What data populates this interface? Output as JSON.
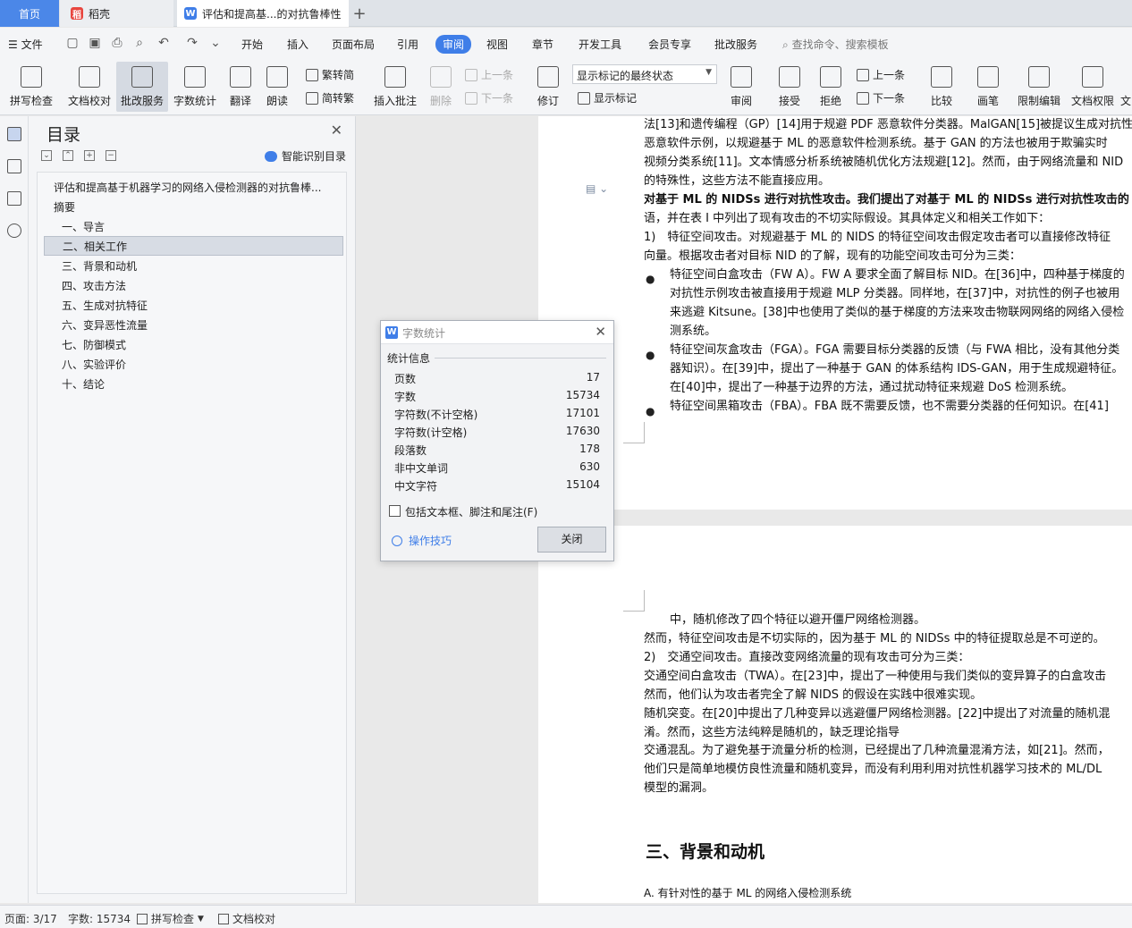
{
  "tabs": {
    "home": "首页",
    "daoke": "稻壳",
    "doc": "评估和提高基...的对抗鲁棒性",
    "plus": "+"
  },
  "menubar": {
    "file": "文件",
    "items": [
      "开始",
      "插入",
      "页面布局",
      "引用",
      "审阅",
      "视图",
      "章节",
      "开发工具",
      "会员专享",
      "批改服务"
    ],
    "active": "审阅",
    "search": "查找命令、搜索模板"
  },
  "ribbon": {
    "spell": "拼写检查",
    "proofread": "文档校对",
    "correction": "批改服务",
    "wordcount": "字数统计",
    "translate": "翻译",
    "read": "朗读",
    "trad": "繁转简",
    "simp": "简转繁",
    "insert_comment": "插入批注",
    "delete": "删除",
    "prev_comment": "上一条",
    "next_comment": "下一条",
    "revise": "修订",
    "markup_state": "显示标记的最终状态",
    "show_markup": "显示标记",
    "review": "审阅",
    "accept": "接受",
    "reject": "拒绝",
    "prev_change": "上一条",
    "next_change": "下一条",
    "compare": "比较",
    "pen": "画笔",
    "restrict": "限制编辑",
    "permission": "文档权限",
    "more": "文"
  },
  "nav": {
    "title": "目录",
    "smart": "智能识别目录",
    "items": [
      "评估和提高基于机器学习的网络入侵检测器的对抗鲁棒...",
      "摘要",
      "一、导言",
      "二、相关工作",
      "三、背景和动机",
      "四、攻击方法",
      "五、生成对抗特征",
      "六、变异恶性流量",
      "七、防御模式",
      "八、实验评价",
      "十、结论"
    ],
    "selected_index": 3
  },
  "dialog": {
    "title": "字数统计",
    "section": "统计信息",
    "stats": [
      {
        "label": "页数",
        "value": "17"
      },
      {
        "label": "字数",
        "value": "15734"
      },
      {
        "label": "字符数(不计空格)",
        "value": "17101"
      },
      {
        "label": "字符数(计空格)",
        "value": "17630"
      },
      {
        "label": "段落数",
        "value": "178"
      },
      {
        "label": "非中文单词",
        "value": "630"
      },
      {
        "label": "中文字符",
        "value": "15104"
      }
    ],
    "include": "包括文本框、脚注和尾注(F)",
    "tips": "操作技巧",
    "close": "关闭"
  },
  "doc": {
    "page1_lines": [
      "法[13]和遗传编程（GP）[14]用于规避 PDF 恶意软件分类器。MalGAN[15]被提议生成对抗性",
      "恶意软件示例，以规避基于 ML 的恶意软件检测系统。基于 GAN 的方法也被用于欺骗实时",
      "视频分类系统[11]。文本情感分析系统被随机优化方法规避[12]。然而，由于网络流量和 NID",
      "的特殊性，这些方法不能直接应用。",
      "对基于 ML 的 NIDSs 进行对抗性攻击。我们提出了对基于 ML 的 NIDSs 进行对抗性攻击的",
      "语，并在表 I 中列出了现有攻击的不切实际假设。其具体定义和相关工作如下：",
      "1)　特征空间攻击。对规避基于 ML 的 NIDS 的特征空间攻击假定攻击者可以直接修改特征",
      "向量。根据攻击者对目标 NID 的了解，现有的功能空间攻击可分为三类："
    ],
    "bullet_lines": [
      "特征空间白盒攻击（FW A）。FW A 要求全面了解目标 NID。在[36]中，四种基于梯度的",
      "对抗性示例攻击被直接用于规避 MLP 分类器。同样地，在[37]中，对抗性的例子也被用",
      "来逃避 Kitsune。[38]中也使用了类似的基于梯度的方法来攻击物联网网络的网络入侵检",
      "测系统。",
      "特征空间灰盒攻击（FGA）。FGA 需要目标分类器的反馈（与 FWA 相比，没有其他分类",
      "器知识）。在[39]中，提出了一种基于 GAN 的体系结构 IDS-GAN，用于生成规避特征。",
      "在[40]中，提出了一种基于边界的方法，通过扰动特征来规避 DoS 检测系统。",
      "特征空间黑箱攻击（FBA）。FBA 既不需要反馈，也不需要分类器的任何知识。在[41]"
    ],
    "page2_lines": [
      "中，随机修改了四个特征以避开僵尸网络检测器。",
      "然而，特征空间攻击是不切实际的，因为基于 ML 的 NIDSs 中的特征提取总是不可逆的。",
      "2)　交通空间攻击。直接改变网络流量的现有攻击可分为三类：",
      "交通空间白盒攻击（TWA）。在[23]中，提出了一种使用与我们类似的变异算子的白盒攻击",
      "然而，他们认为攻击者完全了解 NIDS 的假设在实践中很难实现。",
      "随机突变。在[20]中提出了几种变异以逃避僵尸网络检测器。[22]中提出了对流量的随机混",
      "淆。然而，这些方法纯粹是随机的，缺乏理论指导",
      "交通混乱。为了避免基于流量分析的检测，已经提出了几种流量混淆方法，如[21]。然而，",
      "他们只是简单地模仿良性流量和随机变异，而没有利用利用对抗性机器学习技术的 ML/DL",
      "模型的漏洞。"
    ],
    "heading3": "三、背景和动机",
    "subheading": "A.  有针对性的基于 ML 的网络入侵检测系统"
  },
  "status": {
    "page": "页面: 3/17",
    "words": "字数: 15734",
    "spell": "拼写检查",
    "proof": "文档校对"
  },
  "colors": {
    "accent": "#3f7ee8",
    "tab_home": "#4b87e8",
    "daoke_red": "#e8463f"
  }
}
